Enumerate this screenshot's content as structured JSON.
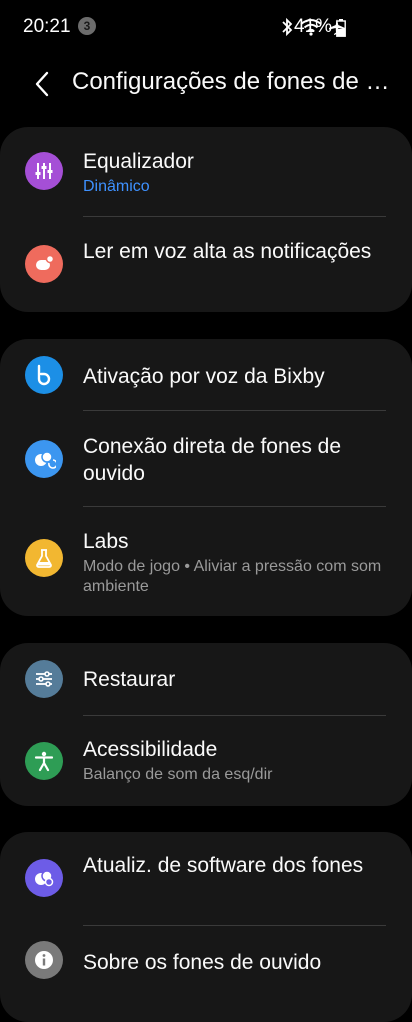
{
  "status_bar": {
    "time": "20:21",
    "notification_count": "3",
    "battery": "41%"
  },
  "header": {
    "title": "Configurações de fones de ouvido"
  },
  "groups": [
    {
      "items": [
        {
          "title": "Equalizador",
          "subtitle": "Dinâmico",
          "icon": "equalizer-icon",
          "color": "#a54fd6"
        },
        {
          "title": "Ler em voz alta as notificações",
          "subtitle": "",
          "icon": "notification-voice-icon",
          "color": "#ef6b5d"
        }
      ]
    },
    {
      "items": [
        {
          "title": "Ativação por voz da Bixby",
          "subtitle": "",
          "icon": "bixby-icon",
          "color": "#1c8fe6"
        },
        {
          "title": "Conexão direta de fones de ouvido",
          "subtitle": "",
          "icon": "earbuds-connect-icon",
          "color": "#3c96f0"
        },
        {
          "title": "Labs",
          "subtitle": "Modo de jogo  •  Aliviar a pressão com som ambiente",
          "icon": "flask-icon",
          "color": "#f2b731"
        }
      ]
    },
    {
      "items": [
        {
          "title": "Restaurar",
          "subtitle": "",
          "icon": "reset-sliders-icon",
          "color": "#557c99"
        },
        {
          "title": "Acessibilidade",
          "subtitle": "Balanço de som da esq/dir",
          "icon": "accessibility-icon",
          "color": "#2e9d55"
        }
      ]
    },
    {
      "items": [
        {
          "title": "Atualiz. de software dos fones",
          "subtitle": "",
          "icon": "software-update-icon",
          "color": "#6d5ce7"
        },
        {
          "title": "Sobre os fones de ouvido",
          "subtitle": "",
          "icon": "info-icon",
          "color": "#7a7a7a"
        }
      ]
    }
  ]
}
